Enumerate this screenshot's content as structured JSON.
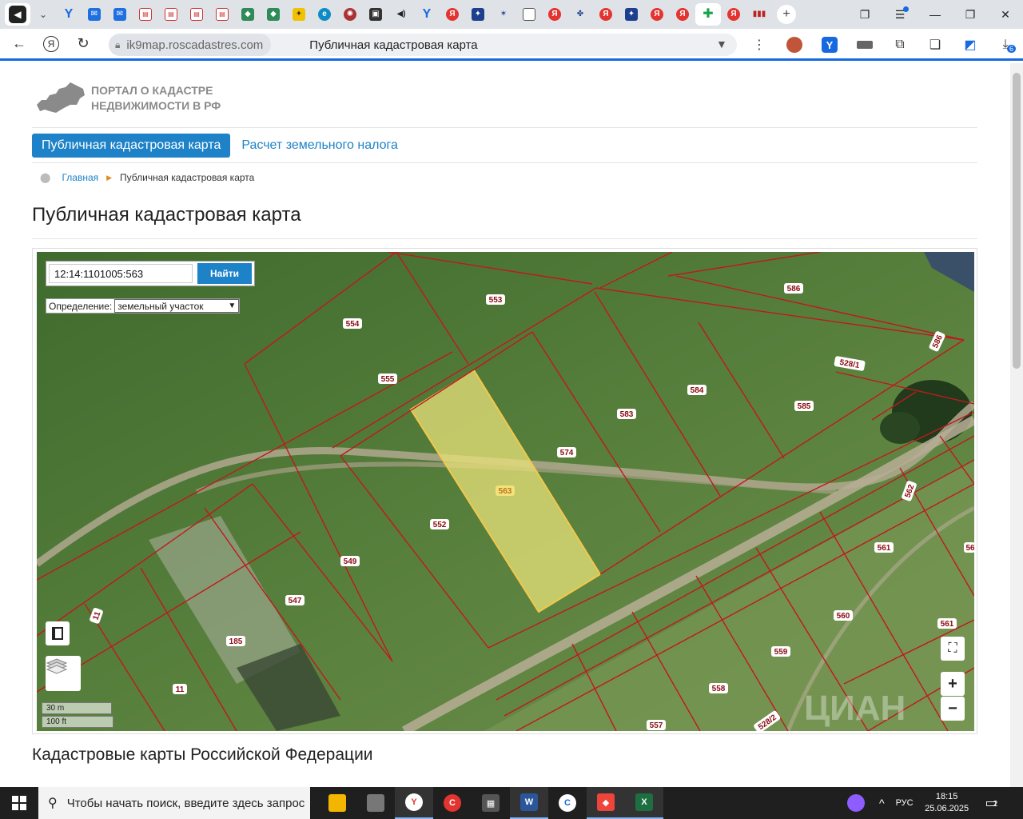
{
  "browser": {
    "url_domain": "ik9map.roscadastres.com",
    "page_title": "Публичная кадастровая карта",
    "download_count": "6",
    "tabs": [
      {
        "icon": "speaker-icon"
      },
      {
        "icon": "chevron-down-icon"
      },
      {
        "icon": "yandex-y-icon"
      },
      {
        "icon": "mail-icon"
      },
      {
        "icon": "mail-icon"
      },
      {
        "icon": "pdf-icon"
      },
      {
        "icon": "pdf-icon"
      },
      {
        "icon": "pdf-icon"
      },
      {
        "icon": "pdf-icon"
      },
      {
        "icon": "gov-shield-icon"
      },
      {
        "icon": "gov-shield-icon"
      },
      {
        "icon": "emblem-icon"
      },
      {
        "icon": "edge-icon"
      },
      {
        "icon": "ornament-icon"
      },
      {
        "icon": "photo-icon"
      },
      {
        "icon": "audio-icon"
      },
      {
        "icon": "yandex-y-icon"
      },
      {
        "icon": "yandex-icon"
      },
      {
        "icon": "emblem-icon"
      },
      {
        "icon": "star-icon"
      },
      {
        "icon": "doc-icon"
      },
      {
        "icon": "yandex-icon"
      },
      {
        "icon": "eagle-icon"
      },
      {
        "icon": "yandex-icon"
      },
      {
        "icon": "emblem-icon"
      },
      {
        "icon": "yandex-icon"
      },
      {
        "icon": "yandex-icon"
      },
      {
        "icon": "cross-icon",
        "active": true
      },
      {
        "icon": "yandex-icon"
      },
      {
        "icon": "wave-icon"
      }
    ]
  },
  "site": {
    "logo_line1": "ПОРТАЛ О КАДАСТРЕ",
    "logo_line2": "НЕДВИЖИМОСТИ В РФ",
    "nav_active": "Публичная кадастровая карта",
    "nav_other": "Расчет земельного налога",
    "breadcrumb_home": "Главная",
    "breadcrumb_current": "Публичная кадастровая карта",
    "heading": "Публичная кадастровая карта",
    "section_heading": "Кадастровые карты Российской Федерации"
  },
  "map": {
    "search_value": "12:14:1101005:563",
    "search_button": "Найти",
    "definition_label": "Определение:",
    "definition_value": "земельный участок",
    "scale_metric": "30 m",
    "scale_imperial": "100 ft",
    "zoom_in": "+",
    "zoom_out": "−",
    "watermark": "ЦИАН",
    "selected_parcel": "563",
    "parcel_labels": [
      "553",
      "586",
      "554",
      "586",
      "528/1",
      "555",
      "584",
      "583",
      "585",
      "574",
      "563",
      "562",
      "552",
      "561",
      "56",
      "549",
      "547",
      "560",
      "561",
      "11",
      "185",
      "559",
      "11",
      "558",
      "528/2",
      "557"
    ]
  },
  "taskbar": {
    "search_placeholder": "Чтобы начать поиск, введите здесь запрос",
    "lang": "РУС",
    "time": "18:15",
    "date": "25.06.2025",
    "notifications": "2"
  }
}
